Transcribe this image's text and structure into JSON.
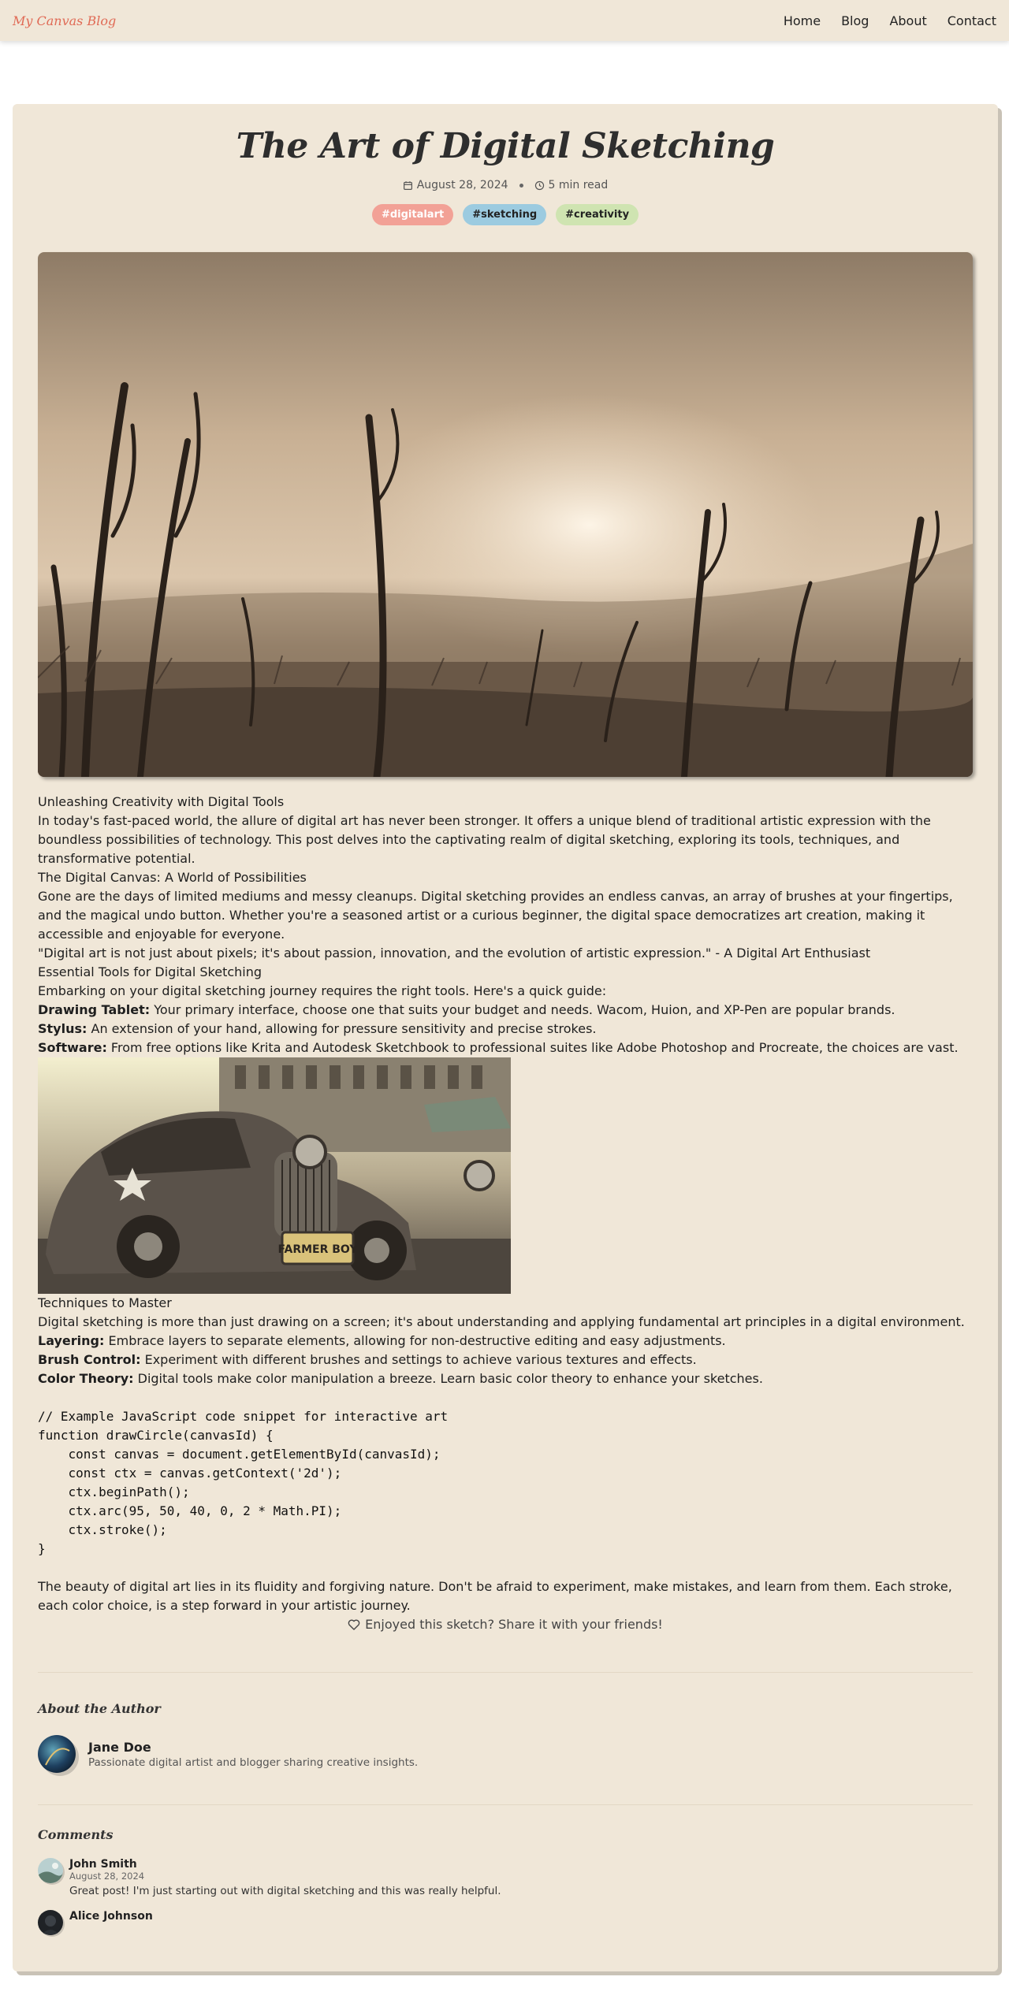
{
  "header": {
    "brand": "My Canvas Blog",
    "nav": [
      "Home",
      "Blog",
      "About",
      "Contact"
    ]
  },
  "post": {
    "title": "The Art of Digital Sketching",
    "date": "August 28, 2024",
    "read_time": "5 min read",
    "tags": [
      "#digitalart",
      "#sketching",
      "#creativity"
    ],
    "paragraphs": {
      "h1": "Unleashing Creativity with Digital Tools",
      "p1": "In today's fast-paced world, the allure of digital art has never been stronger. It offers a unique blend of traditional artistic expression with the boundless possibilities of technology. This post delves into the captivating realm of digital sketching, exploring its tools, techniques, and transformative potential.",
      "h2": "The Digital Canvas: A World of Possibilities",
      "p2": "Gone are the days of limited mediums and messy cleanups. Digital sketching provides an endless canvas, an array of brushes at your fingertips, and the magical undo button. Whether you're a seasoned artist or a curious beginner, the digital space democratizes art creation, making it accessible and enjoyable for everyone.",
      "quote": "\"Digital art is not just about pixels; it's about passion, innovation, and the evolution of artistic expression.\" - A Digital Art Enthusiast",
      "h3": "Essential Tools for Digital Sketching",
      "p3": "Embarking on your digital sketching journey requires the right tools. Here's a quick guide:",
      "tools": [
        {
          "term": "Drawing Tablet:",
          "desc": " Your primary interface, choose one that suits your budget and needs. Wacom, Huion, and XP-Pen are popular brands."
        },
        {
          "term": "Stylus:",
          "desc": " An extension of your hand, allowing for pressure sensitivity and precise strokes."
        },
        {
          "term": "Software:",
          "desc": " From free options like Krita and Autodesk Sketchbook to professional suites like Adobe Photoshop and Procreate, the choices are vast."
        }
      ],
      "h4": "Techniques to Master",
      "p4": "Digital sketching is more than just drawing on a screen; it's about understanding and applying fundamental art principles in a digital environment.",
      "techniques": [
        {
          "term": "Layering:",
          "desc": " Embrace layers to separate elements, allowing for non-destructive editing and easy adjustments."
        },
        {
          "term": "Brush Control:",
          "desc": " Experiment with different brushes and settings to achieve various textures and effects."
        },
        {
          "term": "Color Theory:",
          "desc": " Digital tools make color manipulation a breeze. Learn basic color theory to enhance your sketches."
        }
      ],
      "code": "// Example JavaScript code snippet for interactive art\nfunction drawCircle(canvasId) {\n    const canvas = document.getElementById(canvasId);\n    const ctx = canvas.getContext('2d');\n    ctx.beginPath();\n    ctx.arc(95, 50, 40, 0, 2 * Math.PI);\n    ctx.stroke();\n}",
      "p5": "The beauty of digital art lies in its fluidity and forgiving nature. Don't be afraid to experiment, make mistakes, and learn from them. Each stroke, each color choice, is a step forward in your artistic journey."
    },
    "car_plate": "FARMER BOY",
    "share_text": "Enjoyed this sketch? Share it with your friends!"
  },
  "author": {
    "section_title": "About the Author",
    "name": "Jane Doe",
    "bio": "Passionate digital artist and blogger sharing creative insights."
  },
  "comments": {
    "section_title": "Comments",
    "items": [
      {
        "name": "John Smith",
        "date": "August 28, 2024",
        "text": "Great post! I'm just starting out with digital sketching and this was really helpful."
      },
      {
        "name": "Alice Johnson",
        "date": "",
        "text": ""
      }
    ]
  },
  "colors": {
    "background": "#f0e7d8",
    "brand": "#e06a55",
    "tag_digitalart": "#f2a196",
    "tag_sketching": "#9ccbe0",
    "tag_creativity": "#cfe4b1"
  },
  "icons": [
    "calendar-icon",
    "clock-icon",
    "heart-icon"
  ]
}
